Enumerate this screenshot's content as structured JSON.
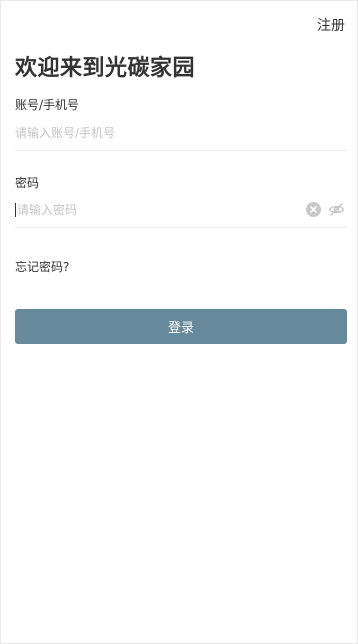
{
  "header": {
    "register_label": "注册"
  },
  "title": "欢迎来到光碳家园",
  "account": {
    "label": "账号/手机号",
    "placeholder": "请输入账号/手机号",
    "value": ""
  },
  "password": {
    "label": "密码",
    "placeholder": "请输入密码",
    "value": ""
  },
  "forgot_label": "忘记密码?",
  "login_label": "登录",
  "colors": {
    "accent": "#66899c",
    "placeholder": "#c4c4c4",
    "text": "#333333",
    "divider": "#eeeeee"
  },
  "icons": {
    "clear": "clear-icon",
    "visibility": "eye-slash-icon"
  }
}
